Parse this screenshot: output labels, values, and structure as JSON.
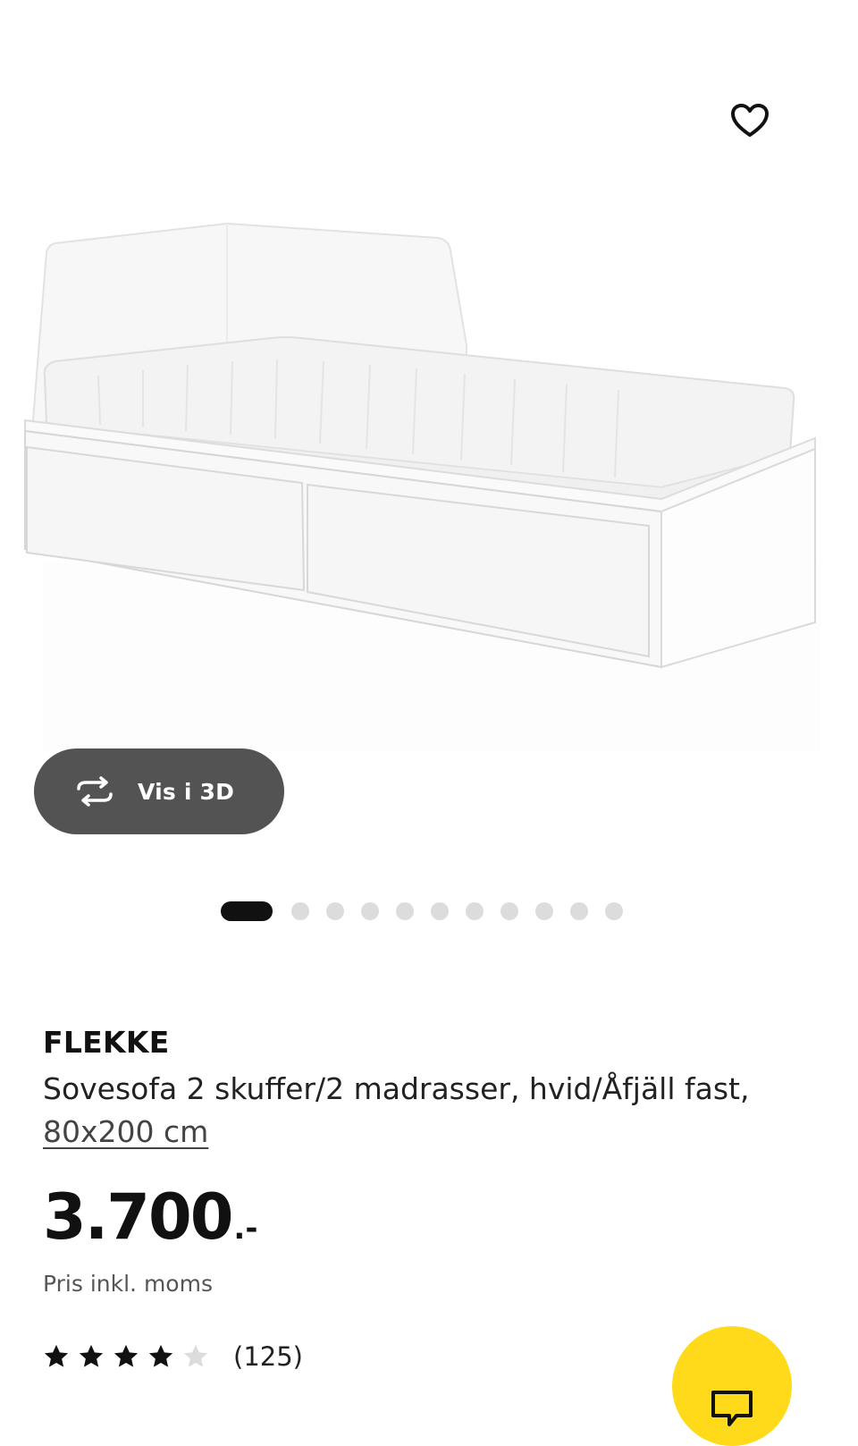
{
  "product": {
    "name": "FLEKKE",
    "description_prefix": "Sovesofa 2 skuffer/2 madrasser, hvid/Åfjäll fast, ",
    "size_link": "80x200 cm",
    "price_amount": "3.700",
    "price_suffix": ".-",
    "price_note": "Pris inkl. moms",
    "rating": {
      "stars": 4,
      "max_stars": 5,
      "count_label": "(125)"
    }
  },
  "viewer": {
    "view_3d_label": "Vis i 3D"
  },
  "carousel": {
    "image_count": 11,
    "active_index": 0
  },
  "icons": {
    "favorite": "heart-outline-icon",
    "rotate": "rotate-arrows-icon",
    "star": "star-icon",
    "chat": "chat-bubble-icon"
  },
  "colors": {
    "accent_yellow": "#ffda1a",
    "pill_background": "#535353",
    "dot_active": "#111111",
    "dot_inactive": "#dcdcdc",
    "star_filled": "#111111",
    "star_empty": "#dcdcdc"
  }
}
